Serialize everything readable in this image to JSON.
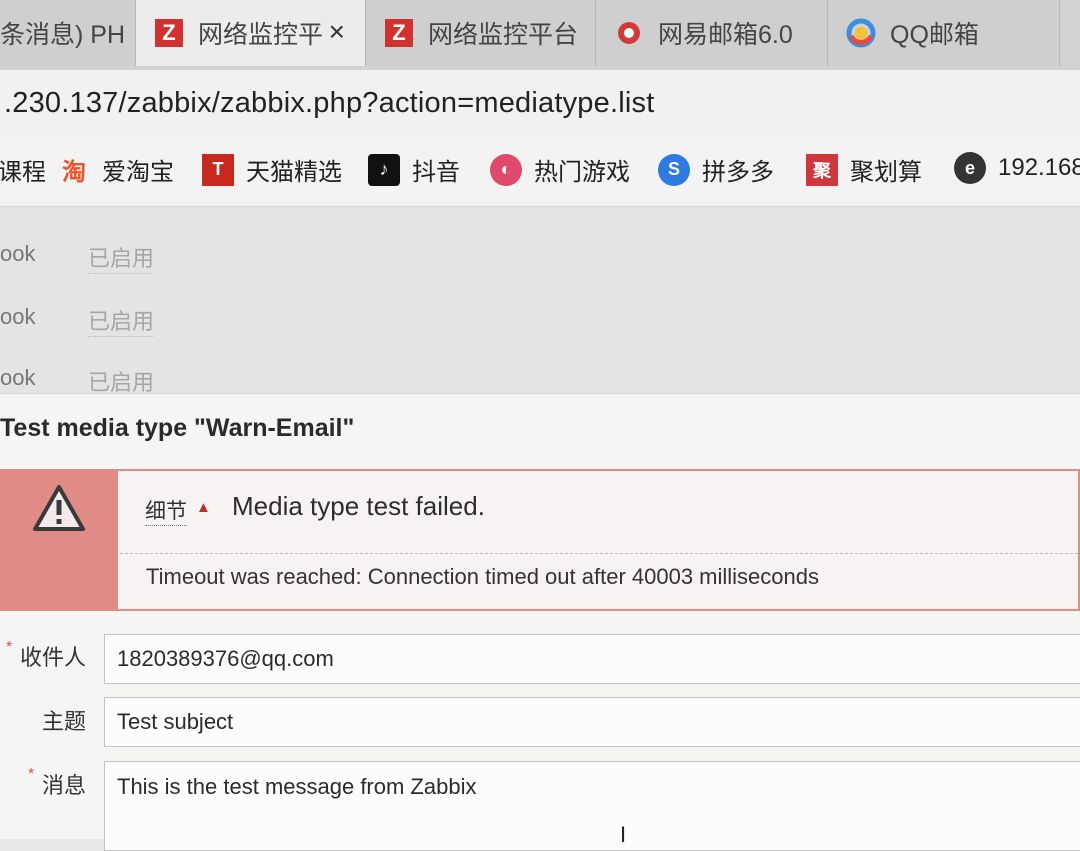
{
  "browser": {
    "tabs": [
      {
        "label": "条消息) PH",
        "active": false
      },
      {
        "label": "网络监控平",
        "active": true,
        "close": "×"
      },
      {
        "label": "网络监控平台",
        "active": false
      },
      {
        "label": "网易邮箱6.0",
        "active": false
      },
      {
        "label": "QQ邮箱",
        "active": false
      }
    ],
    "address_url": ".230.137/zabbix/zabbix.php?action=mediatype.list",
    "bookmarks": [
      {
        "label": "课程",
        "icon": "bookmark-icon"
      },
      {
        "label": "爱淘宝",
        "icon": "taobao-icon",
        "glyph": "淘"
      },
      {
        "label": "天猫精选",
        "icon": "tmall-icon",
        "glyph": "T"
      },
      {
        "label": "抖音",
        "icon": "douyin-icon",
        "glyph": "♪"
      },
      {
        "label": "热门游戏",
        "icon": "game-icon",
        "glyph": "◐"
      },
      {
        "label": "拼多多",
        "icon": "pinduoduo-icon",
        "glyph": "S"
      },
      {
        "label": "聚划算",
        "icon": "juhuasuan-icon",
        "glyph": "聚"
      },
      {
        "label": "192.168",
        "icon": "edge-icon",
        "glyph": "e"
      }
    ]
  },
  "background_rows": [
    {
      "name": "ook",
      "status": "已启用"
    },
    {
      "name": "ook",
      "status": "已启用"
    },
    {
      "name": "ook",
      "status": "已启用"
    }
  ],
  "dialog": {
    "title": "Test media type \"Warn-Email\"",
    "message": {
      "detail_toggle": "细节",
      "arrow": "▲",
      "headline": "Media type test failed.",
      "detail": "Timeout was reached: Connection timed out after 40003 milliseconds"
    },
    "fields": {
      "recipient_label": "收件人",
      "recipient_value": "1820389376@qq.com",
      "subject_label": "主题",
      "subject_value": "Test subject",
      "message_label": "消息",
      "message_value": "This is the test message from Zabbix",
      "required_mark": "*"
    }
  },
  "colors": {
    "error_accent": "#e08b86",
    "zabbix_red": "#d2322f"
  }
}
